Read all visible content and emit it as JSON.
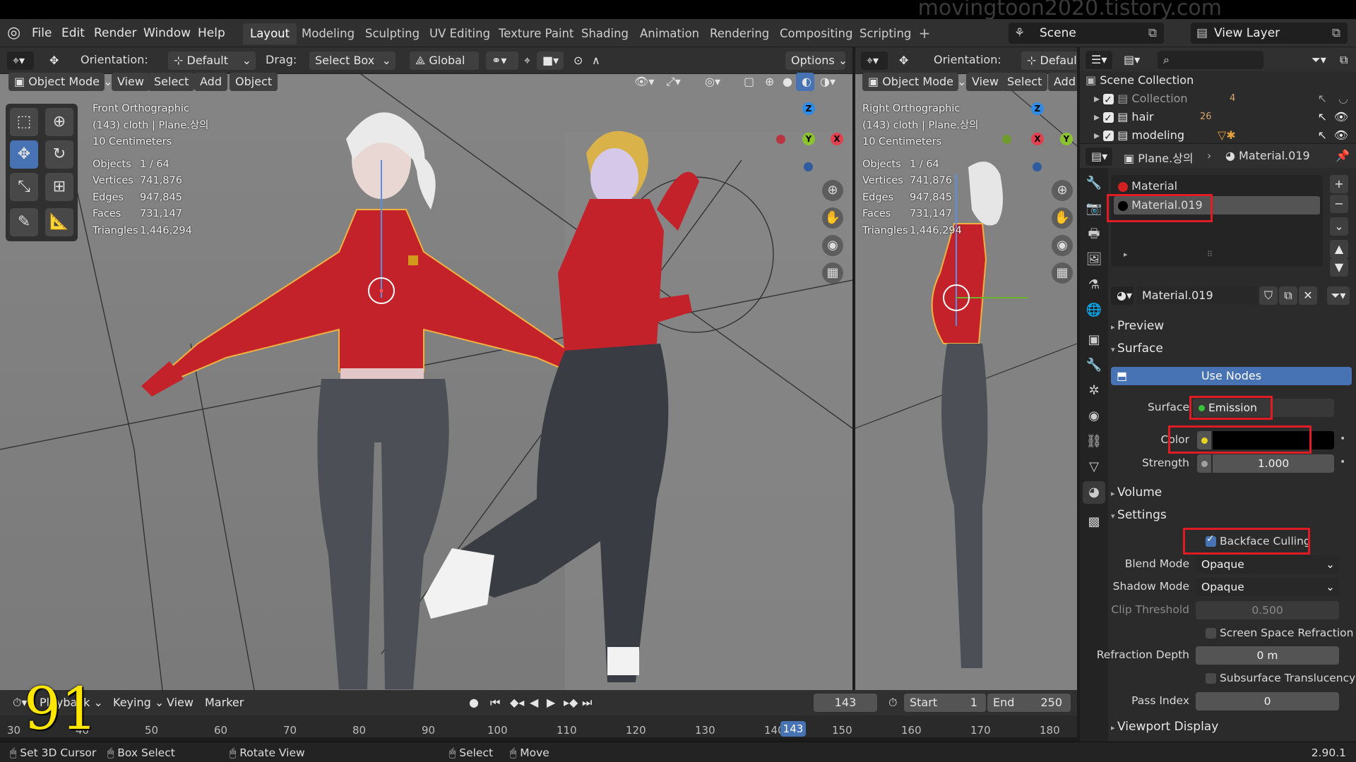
{
  "watermark": "movingtoon2020.tistory.com",
  "menu": [
    "File",
    "Edit",
    "Render",
    "Window",
    "Help"
  ],
  "workspaces": [
    "Layout",
    "Modeling",
    "Sculpting",
    "UV Editing",
    "Texture Paint",
    "Shading",
    "Animation",
    "Rendering",
    "Compositing",
    "Scripting"
  ],
  "active_workspace": "Layout",
  "scene": "Scene",
  "view_layer": "View Layer",
  "viewport_left": {
    "orientation_label": "Orientation:",
    "orientation_value": "Default",
    "drag_label": "Drag:",
    "drag_value": "Select Box",
    "transform_value": "Global",
    "options": "Options",
    "mode": "Object Mode",
    "menus": [
      "View",
      "Select",
      "Add",
      "Object"
    ],
    "view_name": "Front Orthographic",
    "object_info": "(143) cloth | Plane.상의",
    "scale": "10 Centimeters",
    "stats": [
      {
        "k": "Objects",
        "v": "1 / 64"
      },
      {
        "k": "Vertices",
        "v": "741,876"
      },
      {
        "k": "Edges",
        "v": "947,845"
      },
      {
        "k": "Faces",
        "v": "731,147"
      },
      {
        "k": "Triangles",
        "v": "1,446,294"
      }
    ]
  },
  "viewport_right": {
    "orientation_label": "Orientation:",
    "orientation_value": "Defaul",
    "mode": "Object Mode",
    "menus": [
      "View",
      "Select",
      "Add"
    ],
    "view_name": "Right Orthographic",
    "object_info": "(143) cloth | Plane.상의",
    "scale": "10 Centimeters",
    "stats": [
      {
        "k": "Objects",
        "v": "1 / 64"
      },
      {
        "k": "Vertices",
        "v": "741,876"
      },
      {
        "k": "Edges",
        "v": "947,845"
      },
      {
        "k": "Faces",
        "v": "731,147"
      },
      {
        "k": "Triangles",
        "v": "1,446,294"
      }
    ]
  },
  "gizmo": {
    "x": "X",
    "y": "Y",
    "z": "Z"
  },
  "timeline": {
    "playback": "Playback",
    "keying": "Keying",
    "view": "View",
    "marker": "Marker",
    "current_frame": "143",
    "start_label": "Start",
    "start": "1",
    "end_label": "End",
    "end": "250",
    "ruler": [
      "30",
      "40",
      "50",
      "60",
      "70",
      "80",
      "90",
      "100",
      "110",
      "120",
      "130",
      "140",
      "150",
      "160",
      "170",
      "180"
    ],
    "frame_marker": "143"
  },
  "overlay_number": "91",
  "statusbar": {
    "items": [
      "Set 3D Cursor",
      "Box Select",
      "Rotate View",
      "Select",
      "Move"
    ],
    "version": "2.90.1"
  },
  "outliner": {
    "root": "Scene Collection",
    "collections": [
      {
        "name": "Collection",
        "badge": "4"
      },
      {
        "name": "hair",
        "badge": "26"
      },
      {
        "name": "modeling",
        "badge": ""
      }
    ]
  },
  "properties": {
    "object_name": "Plane.상의",
    "material_name": "Material.019",
    "slots": [
      "Material",
      "Material.019"
    ],
    "material_field": "Material.019",
    "preview": "Preview",
    "surface_section": "Surface",
    "use_nodes": "Use Nodes",
    "surface_label": "Surface",
    "surface_value": "Emission",
    "color_label": "Color",
    "color_value": "#000000",
    "strength_label": "Strength",
    "strength_value": "1.000",
    "volume": "Volume",
    "settings": "Settings",
    "backface_culling": "Backface Culling",
    "blend_mode_label": "Blend Mode",
    "blend_mode": "Opaque",
    "shadow_mode_label": "Shadow Mode",
    "shadow_mode": "Opaque",
    "clip_threshold_label": "Clip Threshold",
    "clip_threshold": "0.500",
    "ssr": "Screen Space Refraction",
    "refraction_depth_label": "Refraction Depth",
    "refraction_depth": "0 m",
    "sss": "Subsurface Translucency",
    "pass_index_label": "Pass Index",
    "pass_index": "0",
    "viewport_display": "Viewport Display"
  },
  "colors": {
    "accent_blue": "#4772b3",
    "highlight_red": "#e01b24",
    "sweater_red": "#c4222a",
    "leggings": "#4d4f57",
    "axis_x": "#e2404f",
    "axis_y": "#8bc32f",
    "axis_z": "#2e8ce6"
  }
}
